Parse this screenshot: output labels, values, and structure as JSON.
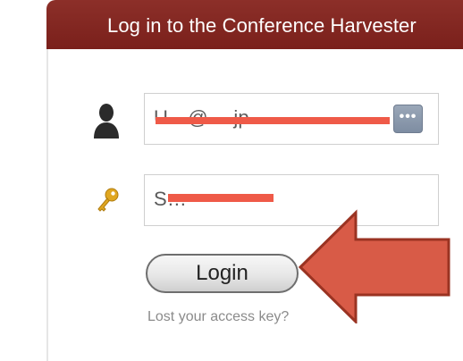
{
  "header": {
    "title": "Log in to the Conference Harvester"
  },
  "form": {
    "username": {
      "value": "U…@….jp",
      "redacted": true
    },
    "access_key": {
      "value": "S…",
      "redacted": true
    },
    "password_manager_button": "•••",
    "login_label": "Login",
    "lost_key_link": "Lost your access key?"
  },
  "icons": {
    "user": "person-icon",
    "key": "key-icon",
    "arrow": "pointing-arrow"
  },
  "colors": {
    "header_bg": "#7a201b",
    "redaction": "#ef5a48",
    "arrow_fill": "#d85b47",
    "arrow_stroke": "#9a3322",
    "link": "#8b8b8b"
  }
}
